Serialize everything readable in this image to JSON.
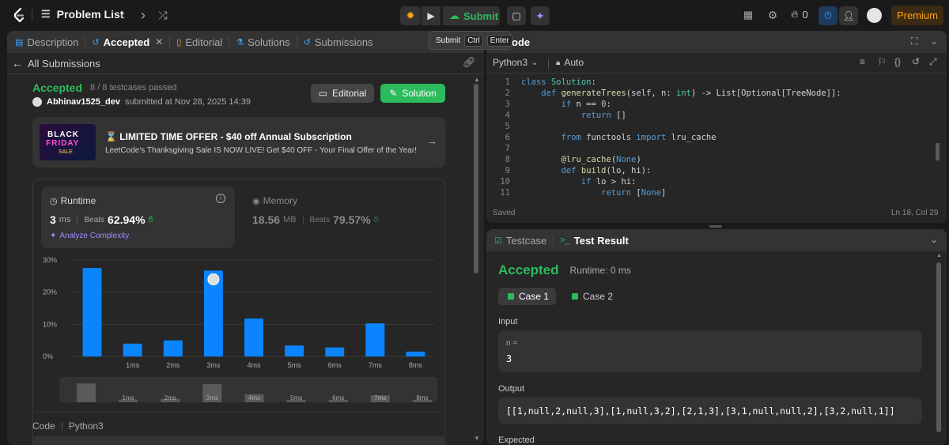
{
  "topbar": {
    "problem_list": "Problem List",
    "submit_label": "Submit",
    "streak_count": "0",
    "premium_label": "Premium"
  },
  "tooltip": {
    "label": "Submit",
    "key1": "Ctrl",
    "key2": "Enter"
  },
  "left_tabs": {
    "description": "Description",
    "accepted": "Accepted",
    "editorial": "Editorial",
    "solutions": "Solutions",
    "submissions": "Submissions"
  },
  "all_submissions": "All Submissions",
  "result": {
    "status": "Accepted",
    "testcases": "8 / 8 testcases passed",
    "user": "Abhinav1525_dev",
    "submitted_text": "submitted at Nov 28, 2025 14:39",
    "editorial_btn": "Editorial",
    "solution_btn": "Solution"
  },
  "promo": {
    "img_line1": "BLACK",
    "img_line2": "FRIDAY",
    "img_line3": "SALE",
    "title": "⌛ LIMITED TIME OFFER - $40 off Annual Subscription",
    "subtitle": "LeetCode's Thanksgiving Sale IS NOW LIVE! Get $40 OFF - Your Final Offer of the Year!"
  },
  "runtime": {
    "label": "Runtime",
    "value": "3",
    "unit": "ms",
    "beats_label": "Beats",
    "beats_value": "62.94%",
    "analyze": "Analyze Complexity"
  },
  "memory": {
    "label": "Memory",
    "value": "18.56",
    "unit": "MB",
    "beats_label": "Beats",
    "beats_value": "79.57%"
  },
  "chart_data": {
    "type": "bar",
    "categories": [
      "",
      "1ms",
      "2ms",
      "3ms",
      "4ms",
      "5ms",
      "6ms",
      "7ms",
      "8ms"
    ],
    "values": [
      27.5,
      4,
      5,
      26.7,
      11.8,
      3.4,
      2.8,
      10.3,
      1.5
    ],
    "ylim": [
      0,
      30
    ],
    "yticks": [
      "30%",
      "20%",
      "10%",
      "0%"
    ],
    "color": "#0a84ff",
    "highlight_index": 3
  },
  "mini_chart": {
    "labels": [
      "1ms",
      "2ms",
      "3ms",
      "4ms",
      "5ms",
      "6ms",
      "7ms",
      "8ms"
    ]
  },
  "code_footer": {
    "label": "Code",
    "lang": "Python3"
  },
  "editor": {
    "title_partial": "ode",
    "language": "Python3",
    "auto": "Auto",
    "status_saved": "Saved",
    "cursor": "Ln 18, Col 29",
    "lines": [
      {
        "n": "1",
        "html": "<span class=\"kw\">class</span> <span class=\"cls\">Solution</span>:"
      },
      {
        "n": "2",
        "html": "    <span class=\"kw\">def</span> <span class=\"fn\">generateTrees</span>(self, n: <span class=\"cls\">int</span>) -> List[Optional[TreeNode]]:"
      },
      {
        "n": "3",
        "html": "        <span class=\"kw\">if</span> n == <span class=\"num\">0</span>:"
      },
      {
        "n": "4",
        "html": "            <span class=\"kw\">return</span> []"
      },
      {
        "n": "5",
        "html": ""
      },
      {
        "n": "6",
        "html": "        <span class=\"kw\">from</span> functools <span class=\"kw\">import</span> lru_cache"
      },
      {
        "n": "7",
        "html": ""
      },
      {
        "n": "8",
        "html": "        @<span class=\"fn\">lru_cache</span>(<span class=\"kw\">None</span>)"
      },
      {
        "n": "9",
        "html": "        <span class=\"kw\">def</span> <span class=\"fn\">build</span>(lo, hi):"
      },
      {
        "n": "10",
        "html": "            <span class=\"kw\">if</span> lo > hi:"
      },
      {
        "n": "11",
        "html": "                <span class=\"kw\">return</span> [<span class=\"kw\">None</span>]"
      }
    ]
  },
  "bottom": {
    "tab_testcase": "Testcase",
    "tab_result": "Test Result",
    "status": "Accepted",
    "runtime": "Runtime: 0 ms",
    "case1": "Case 1",
    "case2": "Case 2",
    "input_label": "Input",
    "input_var": "n =",
    "input_value": "3",
    "output_label": "Output",
    "output_value": "[[1,null,2,null,3],[1,null,3,2],[2,1,3],[3,1,null,null,2],[3,2,null,1]]",
    "expected_label": "Expected"
  }
}
